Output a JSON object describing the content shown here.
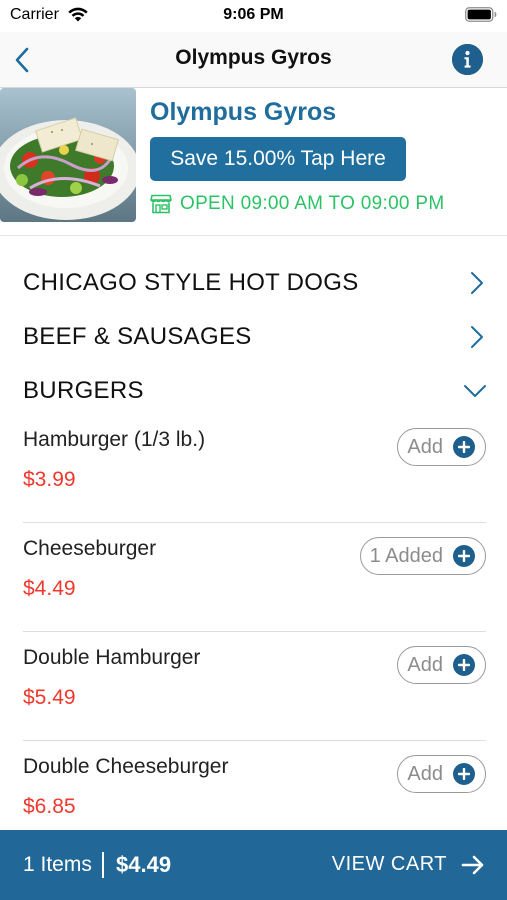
{
  "status_bar": {
    "carrier": "Carrier",
    "time": "9:06 PM"
  },
  "nav": {
    "title": "Olympus Gyros",
    "back_icon": "chevron-left-icon",
    "info_icon": "info-icon"
  },
  "restaurant": {
    "name": "Olympus Gyros",
    "promo_label": "Save 15.00% Tap Here",
    "hours": "OPEN 09:00 AM TO 09:00 PM"
  },
  "categories": [
    {
      "label": "CHICAGO STYLE HOT DOGS",
      "expanded": false
    },
    {
      "label": "BEEF & SAUSAGES",
      "expanded": false
    },
    {
      "label": "BURGERS",
      "expanded": true
    }
  ],
  "items": [
    {
      "name": "Hamburger (1/3 lb.)",
      "price": "$3.99",
      "button": "Add"
    },
    {
      "name": "Cheeseburger",
      "price": "$4.49",
      "button": "1 Added"
    },
    {
      "name": "Double Hamburger",
      "price": "$5.49",
      "button": "Add"
    },
    {
      "name": "Double Cheeseburger",
      "price": "$6.85",
      "button": "Add"
    }
  ],
  "cart": {
    "count_label": "1 Items",
    "total": "$4.49",
    "view_cart_label": "VIEW CART"
  },
  "colors": {
    "accent": "#1f6d9c",
    "price": "#f0382e",
    "open": "#2ec266",
    "cart_bar": "#216898"
  }
}
